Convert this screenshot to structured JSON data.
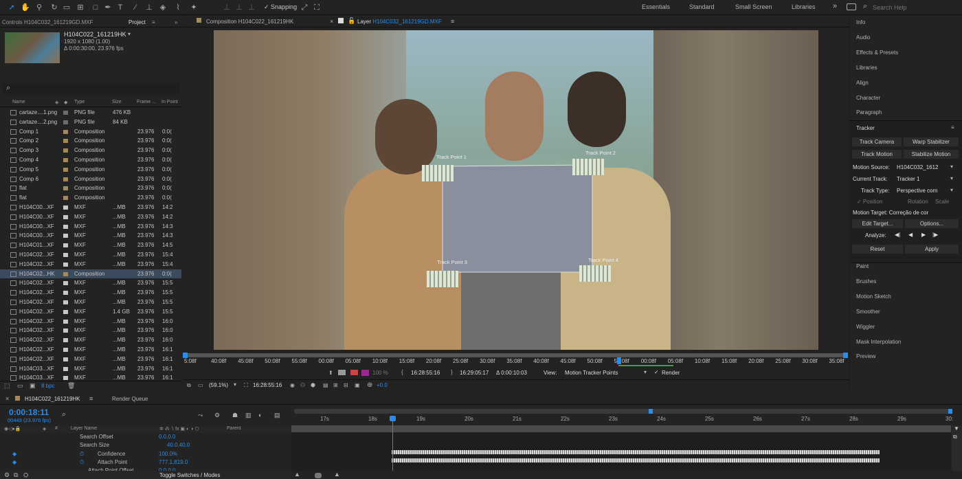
{
  "toolbar": {
    "snapping": "Snapping",
    "workspaces": [
      "Essentials",
      "Standard",
      "Small Screen",
      "Libraries"
    ],
    "more": "»",
    "search_placeholder": "Search Help"
  },
  "project": {
    "controls_title": "Controls H104C032_161219GD.MXF",
    "tab": "Project",
    "selected_name": "H104C022_161219HK",
    "dimensions": "1920 x 1080 (1.00)",
    "duration": "Δ 0:00:30:00, 23.976 fps",
    "search_icon": "⌕",
    "columns": [
      "Name",
      "Type",
      "Size",
      "Frame ...",
      "In Point"
    ],
    "rows": [
      {
        "name": "cartaze....1.png",
        "type": "PNG file",
        "size": "476 KB",
        "fps": "",
        "inp": "",
        "color": "#6d6d6d"
      },
      {
        "name": "cartaze....2.png",
        "type": "PNG file",
        "size": "84 KB",
        "fps": "",
        "inp": "",
        "color": "#6d6d6d"
      },
      {
        "name": "Comp 1",
        "type": "Composition",
        "size": "",
        "fps": "23.976",
        "inp": "0:0(",
        "color": "#a48a5f"
      },
      {
        "name": "Comp 2",
        "type": "Composition",
        "size": "",
        "fps": "23.976",
        "inp": "0:0(",
        "color": "#a48a5f"
      },
      {
        "name": "Comp 3",
        "type": "Composition",
        "size": "",
        "fps": "23.976",
        "inp": "0:0(",
        "color": "#a48a5f"
      },
      {
        "name": "Comp 4",
        "type": "Composition",
        "size": "",
        "fps": "23.976",
        "inp": "0:0(",
        "color": "#a48a5f"
      },
      {
        "name": "Comp 5",
        "type": "Composition",
        "size": "",
        "fps": "23.976",
        "inp": "0:0(",
        "color": "#a48a5f"
      },
      {
        "name": "Comp 6",
        "type": "Composition",
        "size": "",
        "fps": "23.976",
        "inp": "0:0(",
        "color": "#a48a5f"
      },
      {
        "name": "flat",
        "type": "Composition",
        "size": "",
        "fps": "23.976",
        "inp": "0:0(",
        "color": "#a48a5f"
      },
      {
        "name": "flat",
        "type": "Composition",
        "size": "",
        "fps": "23.976",
        "inp": "0:0(",
        "color": "#a48a5f"
      },
      {
        "name": "H104C00...XF",
        "type": "MXF",
        "size": "...MB",
        "fps": "23.976",
        "inp": "14:2",
        "color": "#c7c7c7"
      },
      {
        "name": "H104C00...XF",
        "type": "MXF",
        "size": "...MB",
        "fps": "23.976",
        "inp": "14:2",
        "color": "#c7c7c7"
      },
      {
        "name": "H104C00...XF",
        "type": "MXF",
        "size": "...MB",
        "fps": "23.976",
        "inp": "14:3",
        "color": "#c7c7c7"
      },
      {
        "name": "H104C00...XF",
        "type": "MXF",
        "size": "...MB",
        "fps": "23.976",
        "inp": "14:3",
        "color": "#c7c7c7"
      },
      {
        "name": "H104C01...XF",
        "type": "MXF",
        "size": "...MB",
        "fps": "23.976",
        "inp": "14:5",
        "color": "#c7c7c7"
      },
      {
        "name": "H104C02...XF",
        "type": "MXF",
        "size": "...MB",
        "fps": "23.976",
        "inp": "15:4",
        "color": "#c7c7c7"
      },
      {
        "name": "H104C02...XF",
        "type": "MXF",
        "size": "...MB",
        "fps": "23.976",
        "inp": "15:4",
        "color": "#c7c7c7"
      },
      {
        "name": "H104C02...HK",
        "type": "Composition",
        "size": "",
        "fps": "23.976",
        "inp": "0:0(",
        "color": "#a48a5f",
        "selected": true
      },
      {
        "name": "H104C02...XF",
        "type": "MXF",
        "size": "...MB",
        "fps": "23.976",
        "inp": "15:5",
        "color": "#c7c7c7"
      },
      {
        "name": "H104C02...XF",
        "type": "MXF",
        "size": "...MB",
        "fps": "23.976",
        "inp": "15:5",
        "color": "#c7c7c7"
      },
      {
        "name": "H104C02...XF",
        "type": "MXF",
        "size": "...MB",
        "fps": "23.976",
        "inp": "15:5",
        "color": "#c7c7c7"
      },
      {
        "name": "H104C02...XF",
        "type": "MXF",
        "size": "1.4 GB",
        "fps": "23.976",
        "inp": "15:5",
        "color": "#c7c7c7"
      },
      {
        "name": "H104C02...XF",
        "type": "MXF",
        "size": "...MB",
        "fps": "23.976",
        "inp": "16:0",
        "color": "#c7c7c7"
      },
      {
        "name": "H104C02...XF",
        "type": "MXF",
        "size": "...MB",
        "fps": "23.976",
        "inp": "16:0",
        "color": "#c7c7c7"
      },
      {
        "name": "H104C02...XF",
        "type": "MXF",
        "size": "...MB",
        "fps": "23.976",
        "inp": "16:0",
        "color": "#c7c7c7"
      },
      {
        "name": "H104C02...XF",
        "type": "MXF",
        "size": "...MB",
        "fps": "23.976",
        "inp": "16:1",
        "color": "#c7c7c7"
      },
      {
        "name": "H104C02...XF",
        "type": "MXF",
        "size": "...MB",
        "fps": "23.976",
        "inp": "16:1",
        "color": "#c7c7c7"
      },
      {
        "name": "H104C03...XF",
        "type": "MXF",
        "size": "...MB",
        "fps": "23.976",
        "inp": "16:1",
        "color": "#c7c7c7"
      },
      {
        "name": "H104C03...XF",
        "type": "MXF",
        "size": "...MB",
        "fps": "23.976",
        "inp": "16:1",
        "color": "#c7c7c7"
      }
    ],
    "bpc": "8 bpc"
  },
  "viewer": {
    "tab_comp": "Composition H104C022_161219HK",
    "tab_layer_prefix": "Layer",
    "tab_layer_name": "H104C032_161219GD.MXF",
    "track_points": [
      "Track Point 1",
      "Track Point 2",
      "Track Point 3",
      "Track Point 4"
    ],
    "ruler": [
      "5:08f",
      "40:08f",
      "45:08f",
      "50:08f",
      "55:08f",
      "00:08f",
      "05:08f",
      "10:08f",
      "15:08f",
      "20:08f",
      "25:08f",
      "30:08f",
      "35:08f",
      "40:08f",
      "45:08f",
      "50:08f",
      "55:08f",
      "00:08f",
      "05:08f",
      "10:08f",
      "15:08f",
      "20:08f",
      "25:08f",
      "30:08f",
      "35:08f"
    ],
    "zoom_pct": "100 %",
    "in_time": "16:28:55:16",
    "out_time": "16:29:05:17",
    "dur_time": "Δ 0:00:10:03",
    "view_label": "View:",
    "view_value": "Motion Tracker Points",
    "render_label": "Render",
    "mag": "(59.1%)",
    "cur_time": "16:28:55:16",
    "exposure": "+0.0"
  },
  "right": {
    "top_items": [
      "Info",
      "Audio",
      "Effects & Presets",
      "Libraries",
      "Align",
      "Character",
      "Paragraph"
    ],
    "tracker_title": "Tracker",
    "track_camera": "Track Camera",
    "warp_stabilizer": "Warp Stabilizer",
    "track_motion": "Track Motion",
    "stabilize_motion": "Stabilize Motion",
    "motion_source_label": "Motion Source:",
    "motion_source": "H104C032_1612",
    "current_track_label": "Current Track:",
    "current_track": "Tracker 1",
    "track_type_label": "Track Type:",
    "track_type": "Perspective corn",
    "position": "✓ Position",
    "rotation": "Rotation",
    "scale": "Scale",
    "motion_target": "Motion Target: Correção de cor",
    "edit_target": "Edit Target...",
    "options": "Options...",
    "analyze": "Analyze:",
    "reset": "Reset",
    "apply": "Apply",
    "bottom_items": [
      "Paint",
      "Brushes",
      "Motion Sketch",
      "Smoother",
      "Wiggler",
      "Mask Interpolation",
      "Preview"
    ]
  },
  "timeline": {
    "tab": "H104C022_161219HK",
    "render_queue": "Render Queue",
    "timecode": "0:00:18:11",
    "frame_info": "00443 (23.976 fps)",
    "col_layer": "Layer Name",
    "col_parent": "Parent",
    "col_hash": "#",
    "ticks": [
      "17s",
      "18s",
      "19s",
      "20s",
      "21s",
      "22s",
      "23s",
      "24s",
      "25s",
      "26s",
      "27s",
      "28s",
      "29s",
      "30:"
    ],
    "props": [
      {
        "name": "Search Offset",
        "value": "0.0,0.0"
      },
      {
        "name": "Search Size",
        "value": "40.0,40.0"
      },
      {
        "name": "Confidence",
        "value": "100.0%"
      },
      {
        "name": "Attach Point",
        "value": "777.1,819.0"
      },
      {
        "name": "Attach Point Offset",
        "value": "0.0,0.0"
      }
    ],
    "toggle": "Toggle Switches / Modes",
    "playhead_fraction": 0.092
  },
  "colors": {
    "accent": "#2d8ceb",
    "panel": "#232323",
    "bg": "#1d1d1d",
    "comp": "#a48a5f"
  }
}
